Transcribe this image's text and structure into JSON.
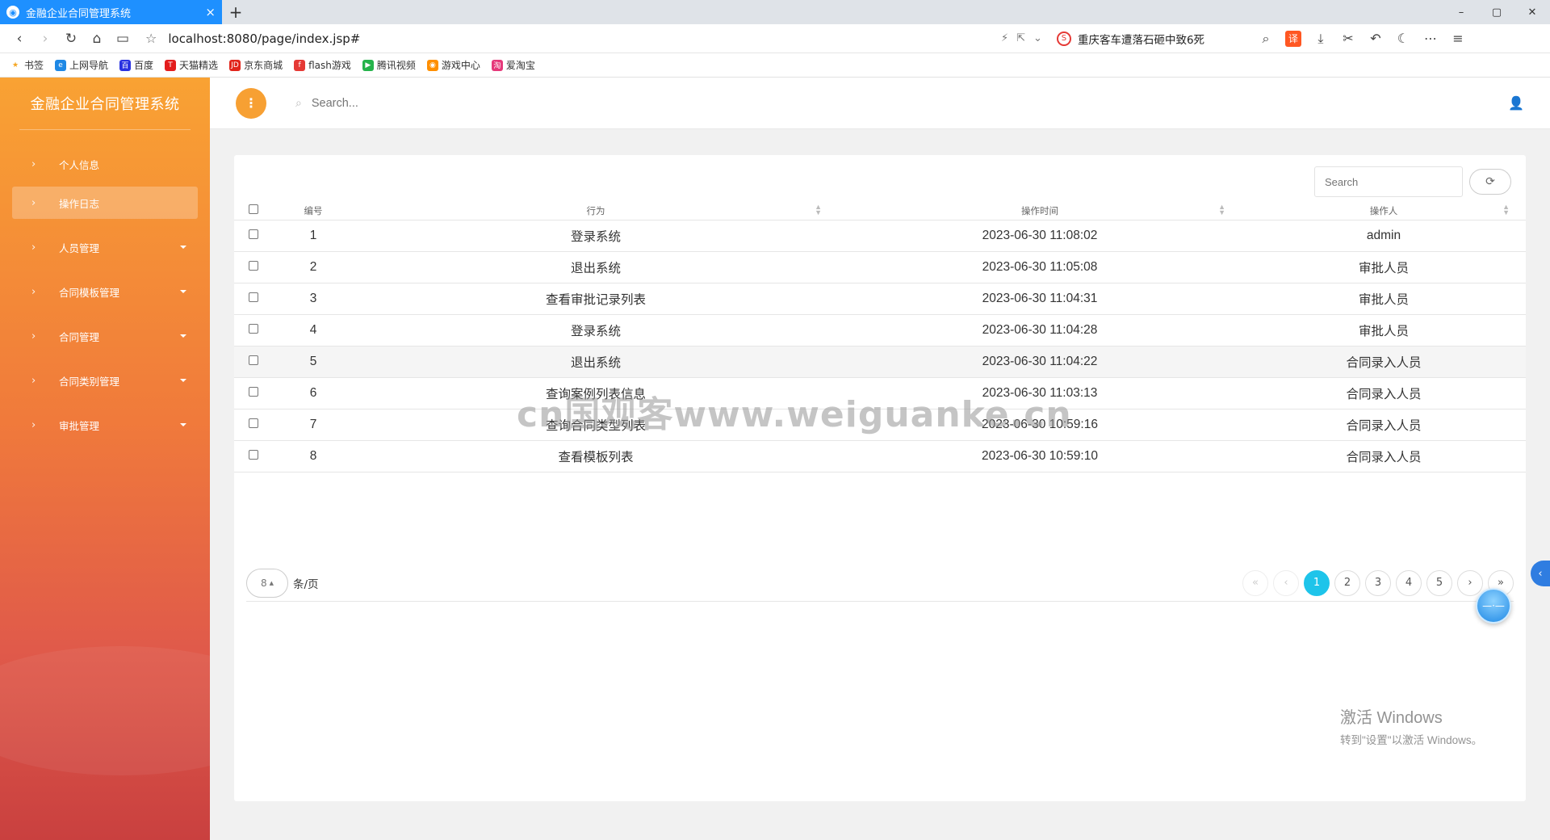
{
  "browser": {
    "tab_title": "金融企业合同管理系统",
    "tab_close": "×",
    "new_tab": "+",
    "url": "localhost:8080/page/index.jsp#",
    "news_text": "重庆客车遭落石砸中致6死",
    "translate_label": "译",
    "window_min": "–",
    "window_max": "▢",
    "window_close": "✕"
  },
  "bookmarks": [
    {
      "label": "书签",
      "icon": "★",
      "color": "#f5a623"
    },
    {
      "label": "上网导航",
      "icon": "e",
      "color": "#1e88e5"
    },
    {
      "label": "百度",
      "icon": "百",
      "color": "#2932e1"
    },
    {
      "label": "天猫精选",
      "icon": "T",
      "color": "#e31d1d"
    },
    {
      "label": "京东商城",
      "icon": "JD",
      "color": "#e1251b"
    },
    {
      "label": "flash游戏",
      "icon": "f",
      "color": "#e53935"
    },
    {
      "label": "腾讯视频",
      "icon": "▶",
      "color": "#25b34b"
    },
    {
      "label": "游戏中心",
      "icon": "◉",
      "color": "#ff8f00"
    },
    {
      "label": "爱淘宝",
      "icon": "淘",
      "color": "#e5397a"
    }
  ],
  "sidebar": {
    "title": "金融企业合同管理系统",
    "items": [
      {
        "label": "个人信息",
        "has_caret": false,
        "active": false
      },
      {
        "label": "操作日志",
        "has_caret": false,
        "active": true
      },
      {
        "label": "人员管理",
        "has_caret": true,
        "active": false
      },
      {
        "label": "合同模板管理",
        "has_caret": true,
        "active": false
      },
      {
        "label": "合同管理",
        "has_caret": true,
        "active": false
      },
      {
        "label": "合同类别管理",
        "has_caret": true,
        "active": false
      },
      {
        "label": "审批管理",
        "has_caret": true,
        "active": false
      }
    ]
  },
  "topbar": {
    "search_placeholder": "Search..."
  },
  "table": {
    "search_placeholder": "Search",
    "columns": [
      "编号",
      "行为",
      "操作时间",
      "操作人"
    ],
    "rows": [
      {
        "id": "1",
        "action": "登录系统",
        "time": "2023-06-30 11:08:02",
        "operator": "admin"
      },
      {
        "id": "2",
        "action": "退出系统",
        "time": "2023-06-30 11:05:08",
        "operator": "审批人员"
      },
      {
        "id": "3",
        "action": "查看审批记录列表",
        "time": "2023-06-30 11:04:31",
        "operator": "审批人员"
      },
      {
        "id": "4",
        "action": "登录系统",
        "time": "2023-06-30 11:04:28",
        "operator": "审批人员"
      },
      {
        "id": "5",
        "action": "退出系统",
        "time": "2023-06-30 11:04:22",
        "operator": "合同录入人员"
      },
      {
        "id": "6",
        "action": "查询案例列表信息",
        "time": "2023-06-30 11:03:13",
        "operator": "合同录入人员"
      },
      {
        "id": "7",
        "action": "查询合同类型列表",
        "time": "2023-06-30 10:59:16",
        "operator": "合同录入人员"
      },
      {
        "id": "8",
        "action": "查看模板列表",
        "time": "2023-06-30 10:59:10",
        "operator": "合同录入人员"
      }
    ],
    "highlighted_row": 5
  },
  "pagination": {
    "page_size": "8",
    "page_size_label": "条/页",
    "first": "«",
    "prev": "‹",
    "pages": [
      "1",
      "2",
      "3",
      "4",
      "5"
    ],
    "current": "1",
    "next": "›",
    "last": "»"
  },
  "watermark": "cn国观客www.weiguanke.cn",
  "windows_activation": {
    "line1": "激活 Windows",
    "line2": "转到\"设置\"以激活 Windows。"
  }
}
